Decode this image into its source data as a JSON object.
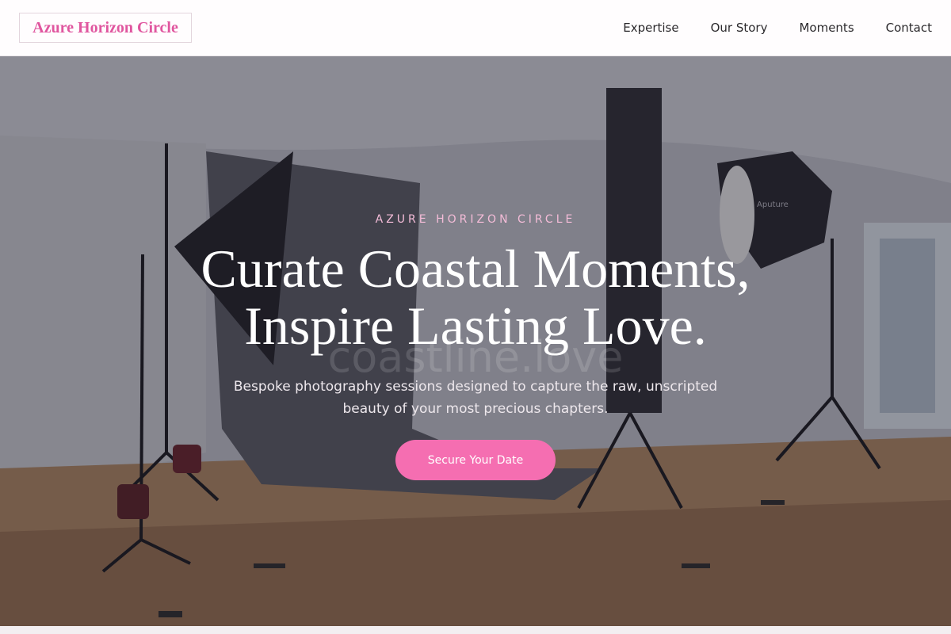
{
  "header": {
    "logo": "Azure Horizon Circle",
    "nav": [
      "Expertise",
      "Our Story",
      "Moments",
      "Contact"
    ]
  },
  "hero": {
    "eyebrow": "AZURE HORIZON CIRCLE",
    "headline_line1": "Curate Coastal Moments,",
    "headline_line2": "Inspire Lasting Love.",
    "subtext": "Bespoke photography sessions designed to capture the raw, unscripted beauty of your most precious chapters.",
    "cta": "Secure Your Date",
    "watermark": "coastline.love",
    "softbox_brand": "Aputure"
  },
  "colors": {
    "accent": "#f56eb1",
    "logo": "#e0569f",
    "eyebrow": "#f4bcd8"
  }
}
